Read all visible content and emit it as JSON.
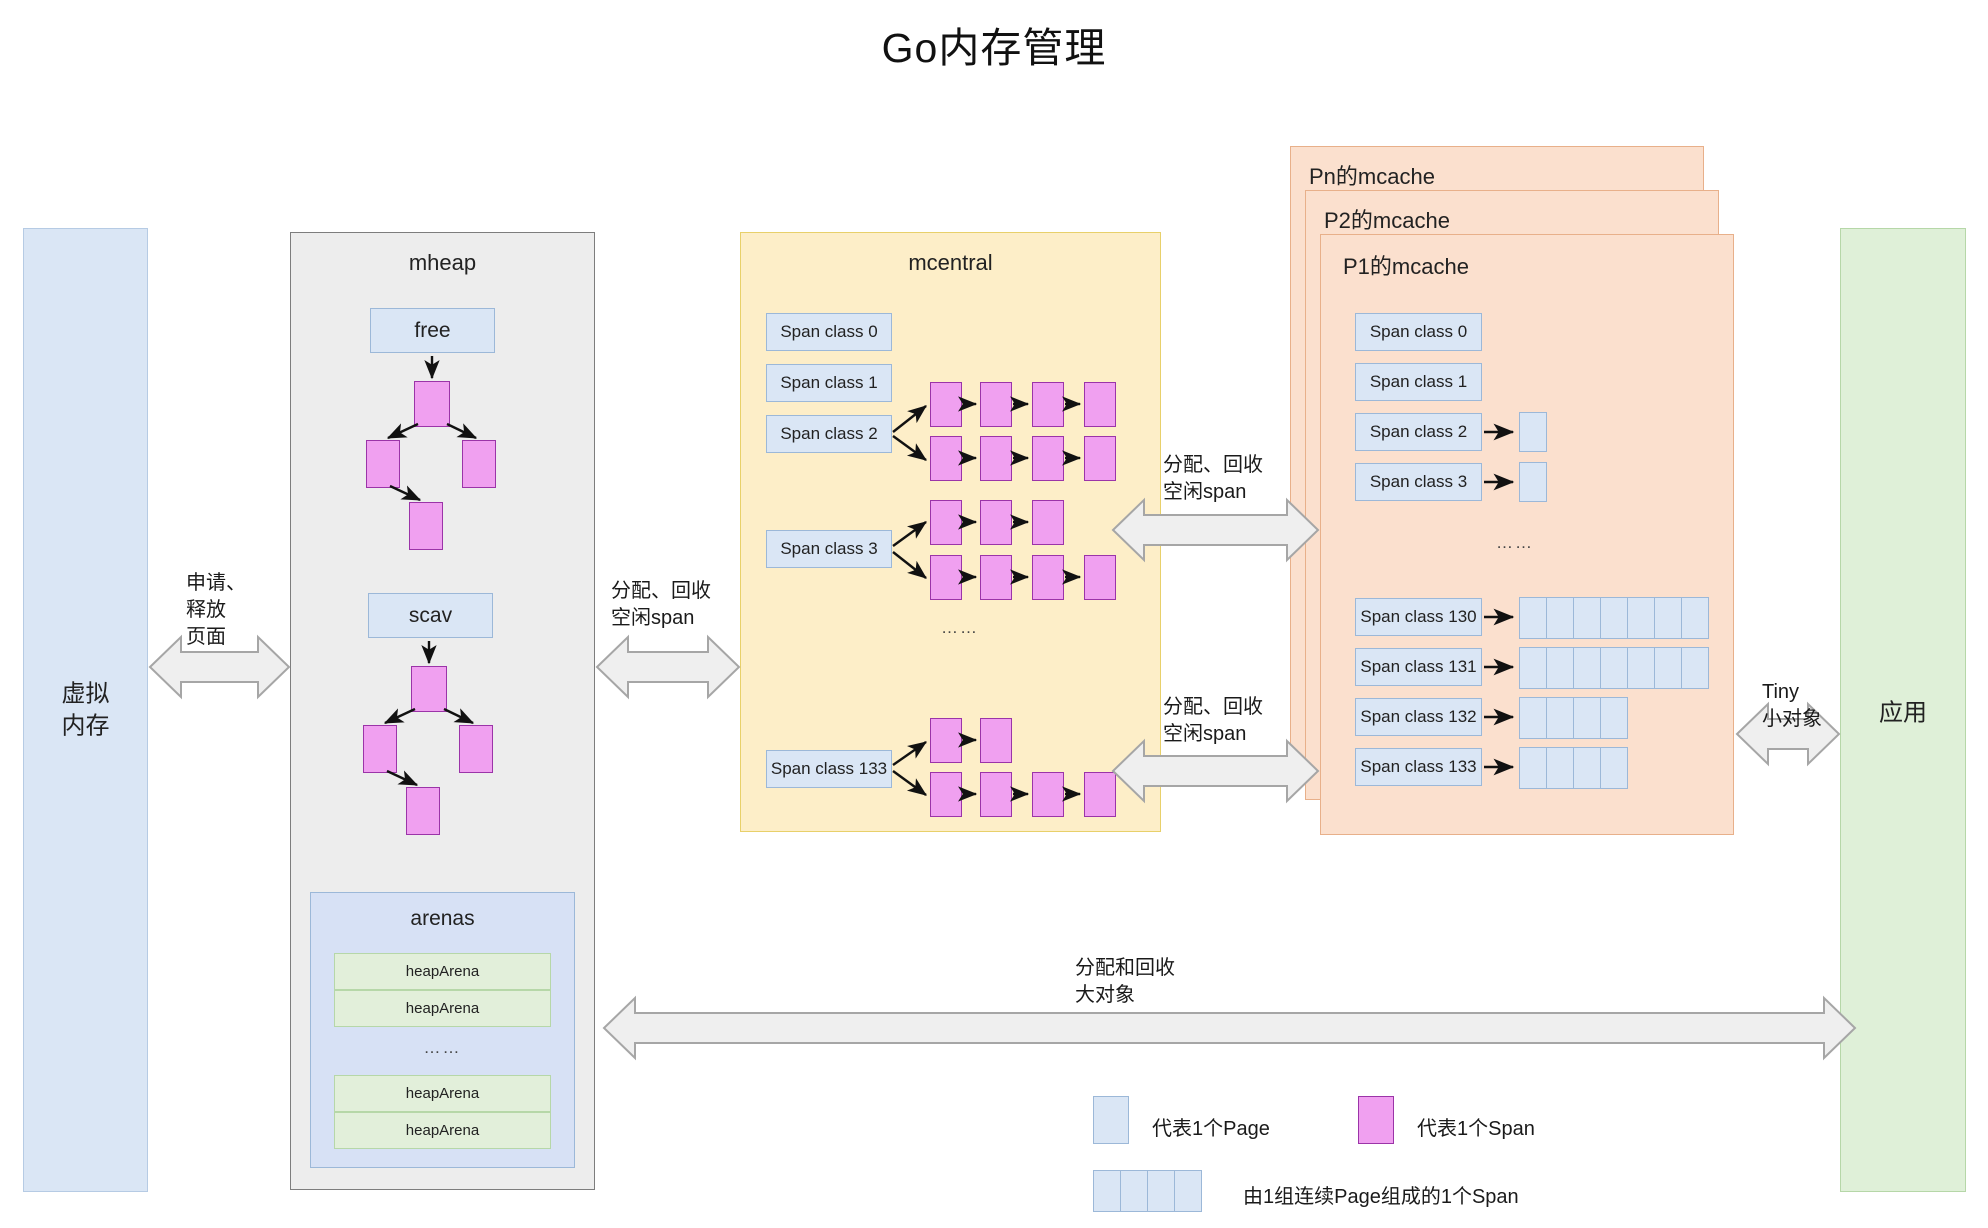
{
  "title": "Go内存管理",
  "panels": {
    "virtual_memory": "虚拟\n内存",
    "virtual_memory_line1": "虚拟",
    "virtual_memory_line2": "内存",
    "mheap": "mheap",
    "mcentral": "mcentral",
    "application": "应用",
    "mcache_pn": "Pn的mcache",
    "mcache_p2": "P2的mcache",
    "mcache_p1": "P1的mcache"
  },
  "mheap": {
    "free_label": "free",
    "scav_label": "scav",
    "arenas_label": "arenas",
    "heap_arena_label": "heapArena",
    "heap_arenas": [
      "heapArena",
      "heapArena",
      "heapArena",
      "heapArena"
    ],
    "ellipsis": "……",
    "free_tree_nodes": 4,
    "scav_tree_nodes": 4
  },
  "mcentral": {
    "ellipsis": "……",
    "span_classes": [
      {
        "label": "Span class 0",
        "chains": []
      },
      {
        "label": "Span class 1",
        "chains": []
      },
      {
        "label": "Span class 2",
        "chains": [
          4,
          4
        ]
      },
      {
        "label": "Span class 3",
        "chains": [
          3,
          4
        ]
      },
      {
        "label": "Span class 133",
        "chains": [
          2,
          4
        ]
      }
    ]
  },
  "mcache": {
    "ellipsis": "……",
    "span_classes": [
      {
        "label": "Span class 0",
        "pages": 0
      },
      {
        "label": "Span class 1",
        "pages": 0
      },
      {
        "label": "Span class 2",
        "pages": 1
      },
      {
        "label": "Span class 3",
        "pages": 1
      },
      {
        "label": "Span class 130",
        "pages": 7
      },
      {
        "label": "Span class 131",
        "pages": 7
      },
      {
        "label": "Span class 132",
        "pages": 4
      },
      {
        "label": "Span class 133",
        "pages": 4
      }
    ]
  },
  "arrows": {
    "vmem_mheap_l1": "申请、",
    "vmem_mheap_l2": "释放",
    "vmem_mheap_l3": "页面",
    "mheap_mcentral_l1": "分配、回收",
    "mheap_mcentral_l2": "空闲span",
    "mcentral_mcache_top_l1": "分配、回收",
    "mcentral_mcache_top_l2": "空闲span",
    "mcentral_mcache_bottom_l1": "分配、回收",
    "mcentral_mcache_bottom_l2": "空闲span",
    "mcache_app_l1": "Tiny",
    "mcache_app_l2": "小对象",
    "bigobj_l1": "分配和回收",
    "bigobj_l2": "大对象"
  },
  "legend": {
    "page_label": "代表1个Page",
    "span_label": "代表1个Span",
    "group_label": "由1组连续Page组成的1个Span",
    "group_cells": 4
  },
  "colors": {
    "page_blue_fill": "#dae6f5",
    "page_blue_border": "#9cb8d8",
    "span_purple_fill": "#f0a0f0",
    "span_purple_border": "#9b34a8",
    "mheap_gray": "#ededed",
    "mcentral_yellow": "#fdeec8",
    "mcache_orange": "#fbe0ce",
    "app_green": "#dff0d8",
    "arena_green": "#e2efda",
    "arrow_fill": "#efefef",
    "arrow_stroke": "#a6a6a6"
  }
}
